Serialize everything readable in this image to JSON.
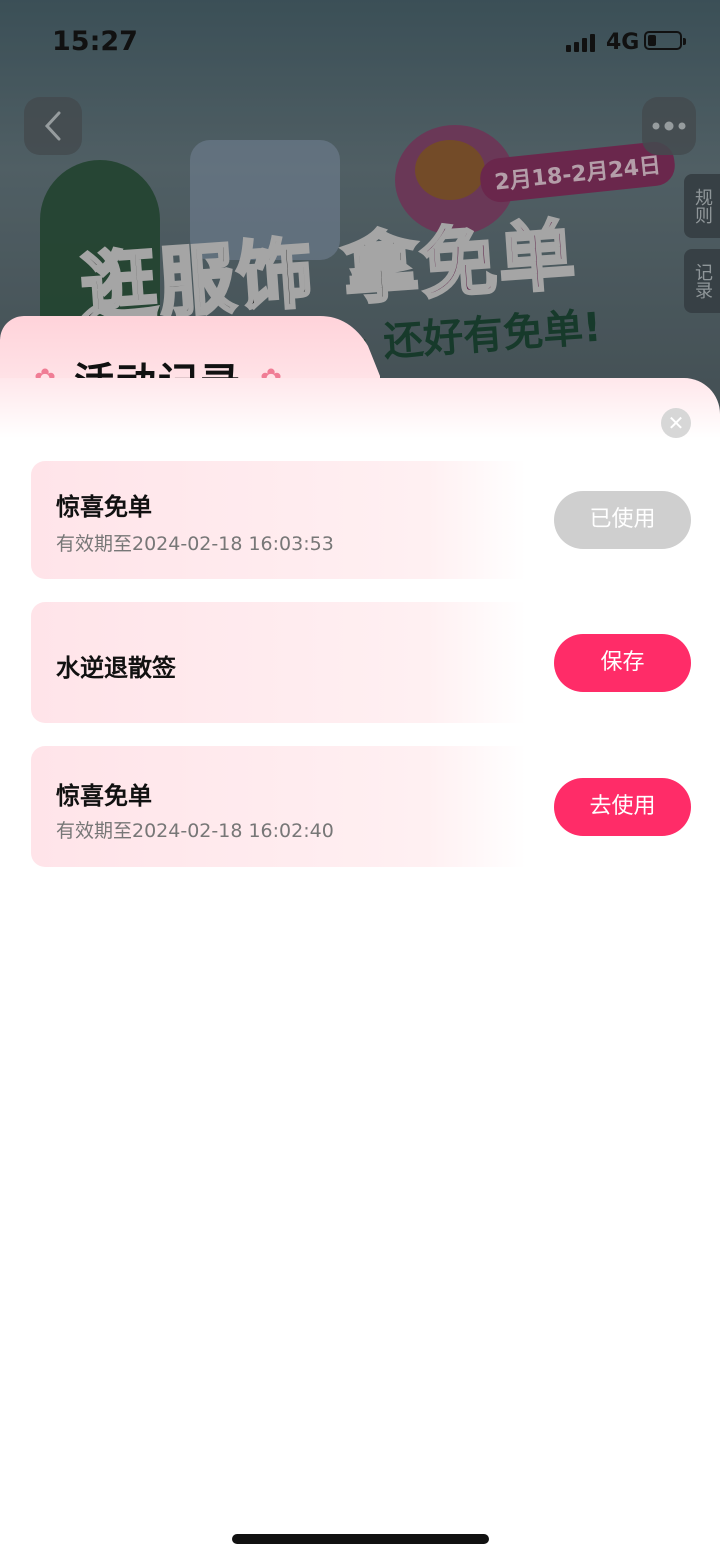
{
  "status_bar": {
    "time": "15:27",
    "network": "4G"
  },
  "hero": {
    "headline_black": "逛服饰 拿",
    "headline_pink": "免单",
    "subline": "班 · 还好有免单!",
    "date_range": "2月18-2月24日",
    "side_tabs": [
      "规则",
      "记录"
    ]
  },
  "sheet": {
    "title": "活动记录",
    "records": [
      {
        "name": "惊喜免单",
        "expiry": "有效期至2024-02-18 16:03:53",
        "button": "已使用",
        "state": "used"
      },
      {
        "name": "水逆退散签",
        "expiry": "",
        "button": "保存",
        "state": "active"
      },
      {
        "name": "惊喜免单",
        "expiry": "有效期至2024-02-18 16:02:40",
        "button": "去使用",
        "state": "active"
      }
    ]
  },
  "colors": {
    "accent": "#ff2c68",
    "used": "#cfcfcf"
  }
}
